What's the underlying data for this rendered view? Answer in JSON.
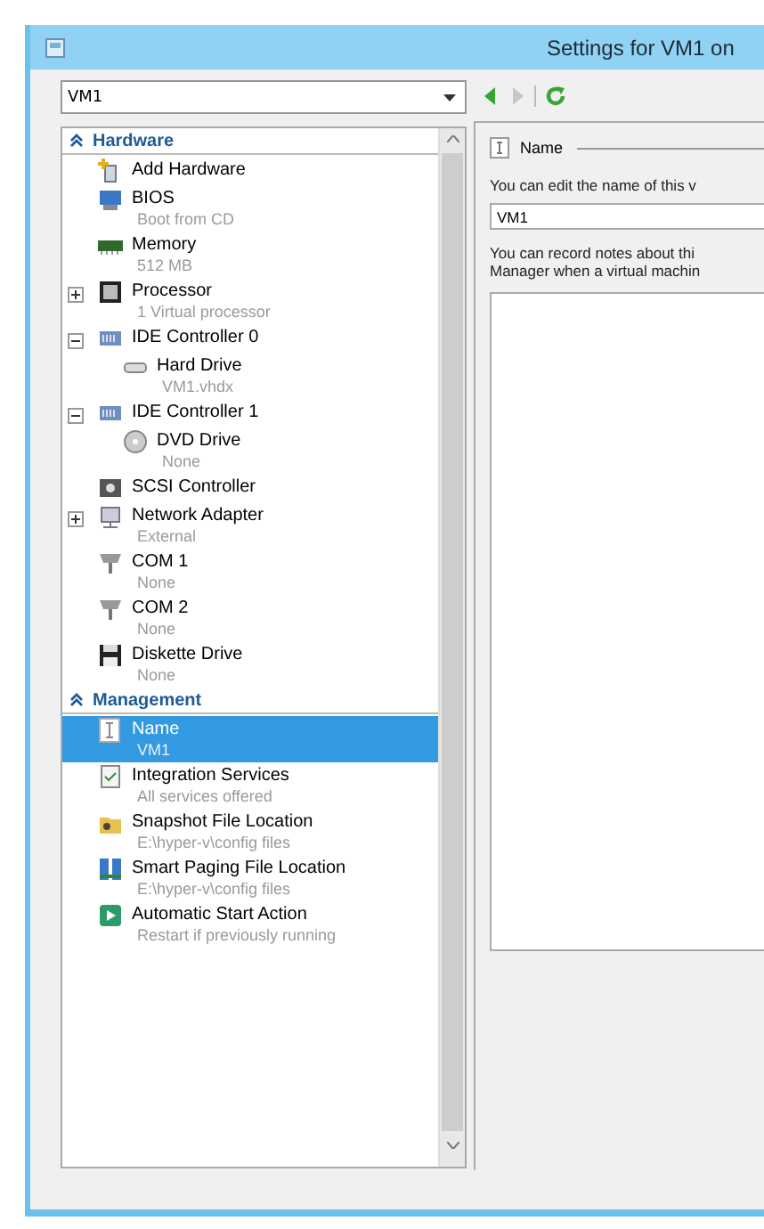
{
  "window": {
    "title": "Settings for VM1 on"
  },
  "vm_selector": {
    "value": "VM1"
  },
  "nav_buttons": [
    {
      "kind": "back",
      "disabled": false
    },
    {
      "kind": "forward",
      "disabled": true
    },
    {
      "kind": "refresh",
      "disabled": false
    }
  ],
  "tree": [
    {
      "kind": "header",
      "label": "Hardware",
      "children": [
        {
          "kind": "add",
          "label": "Add Hardware",
          "selected": false
        },
        {
          "kind": "bios",
          "label": "BIOS",
          "detail": "Boot from CD",
          "selected": false
        },
        {
          "kind": "memory",
          "label": "Memory",
          "detail": "512 MB",
          "selected": false
        },
        {
          "kind": "chip",
          "label": "Processor",
          "detail": "1 Virtual processor",
          "selected": false,
          "expanded": false
        },
        {
          "kind": "controller",
          "label": "IDE Controller 0",
          "selected": false,
          "expanded": true,
          "children": [
            {
              "kind": "disk",
              "label": "Hard Drive",
              "detail": "VM1.vhdx",
              "selected": false
            }
          ]
        },
        {
          "kind": "controller",
          "label": "IDE Controller 1",
          "selected": false,
          "expanded": true,
          "children": [
            {
              "kind": "dvd",
              "label": "DVD Drive",
              "detail": "None",
              "selected": false
            }
          ]
        },
        {
          "kind": "scsi",
          "label": "SCSI Controller",
          "selected": false
        },
        {
          "kind": "network",
          "label": "Network Adapter",
          "detail": "External",
          "selected": false,
          "expanded": false
        },
        {
          "kind": "port",
          "label": "COM 1",
          "detail": "None",
          "selected": false
        },
        {
          "kind": "port",
          "label": "COM 2",
          "detail": "None",
          "selected": false
        },
        {
          "kind": "floppy",
          "label": "Diskette Drive",
          "detail": "None",
          "selected": false
        }
      ]
    },
    {
      "kind": "header",
      "label": "Management",
      "children": [
        {
          "kind": "name",
          "label": "Name",
          "detail": "VM1",
          "selected": true
        },
        {
          "kind": "services",
          "label": "Integration Services",
          "detail": "All services offered",
          "selected": false
        },
        {
          "kind": "folder",
          "label": "Snapshot File Location",
          "detail": "E:\\hyper-v\\config files",
          "selected": false
        },
        {
          "kind": "paging",
          "label": "Smart Paging File Location",
          "detail": "E:\\hyper-v\\config files",
          "selected": false
        },
        {
          "kind": "start",
          "label": "Automatic Start Action",
          "detail": "Restart if previously running",
          "selected": false
        }
      ]
    }
  ],
  "settings": {
    "section_title": "Name",
    "name_hint": "You can edit the name of this v",
    "name_value": "VM1",
    "notes_hint": [
      "You can record notes about thi",
      "Manager when a virtual machin"
    ]
  }
}
